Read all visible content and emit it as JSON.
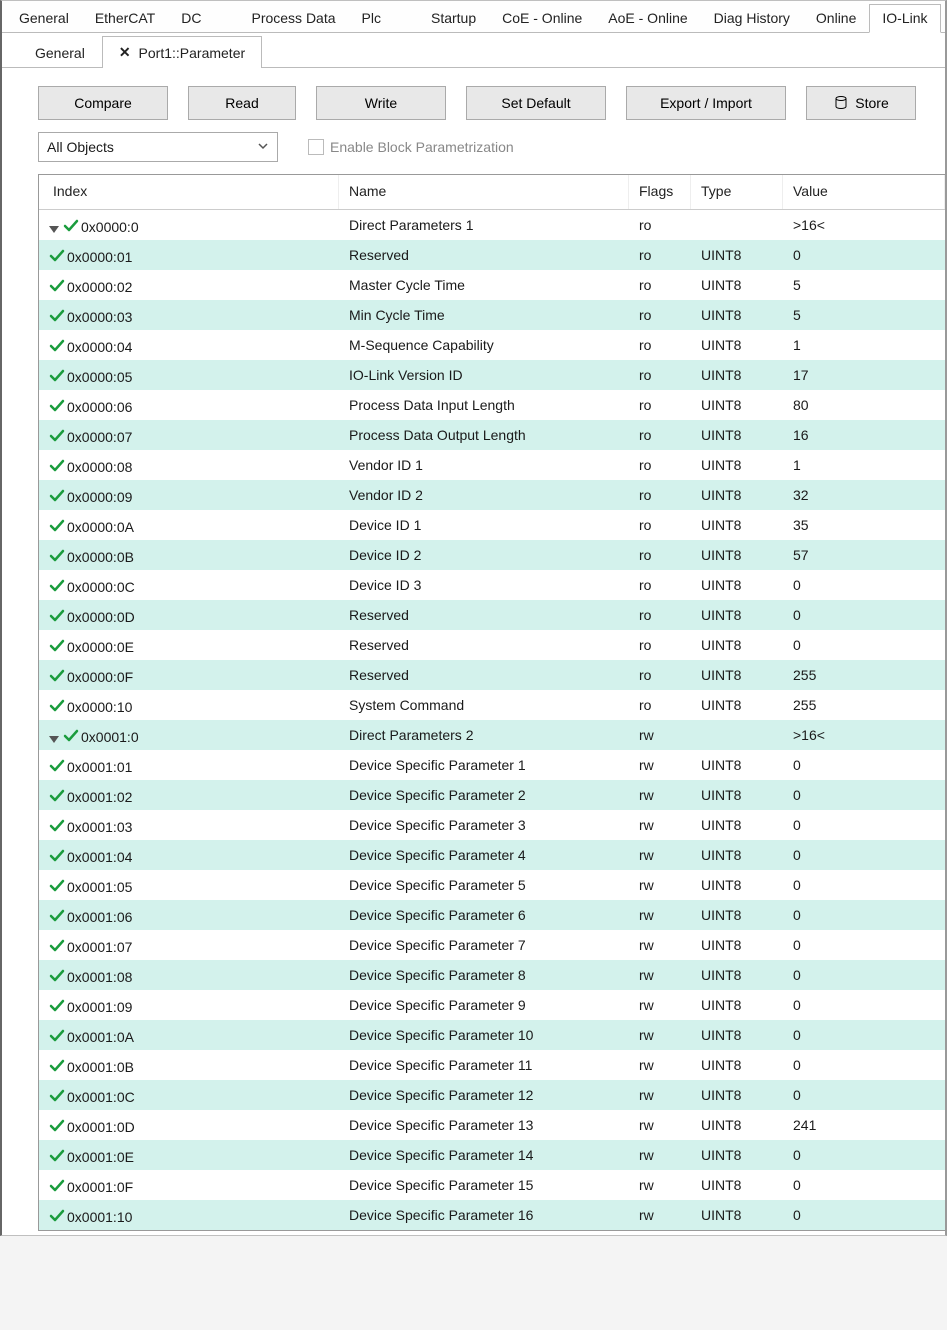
{
  "topTabs": [
    "General",
    "EtherCAT",
    "DC",
    "Process Data",
    "Plc",
    "Startup",
    "CoE - Online",
    "AoE - Online",
    "Diag History",
    "Online",
    "IO-Link"
  ],
  "topTabActive": 10,
  "subTabs": [
    {
      "label": "General",
      "closable": false
    },
    {
      "label": "Port1::Parameter",
      "closable": true
    }
  ],
  "subTabActive": 1,
  "toolbar": {
    "compare": "Compare",
    "read": "Read",
    "write": "Write",
    "setdefault": "Set Default",
    "exportimport": "Export / Import",
    "store": "Store"
  },
  "filter": {
    "dropdown": "All Objects",
    "checkbox": "Enable Block Parametrization"
  },
  "columns": {
    "index": "Index",
    "name": "Name",
    "flags": "Flags",
    "type": "Type",
    "value": "Value"
  },
  "rows": [
    {
      "kind": "parent",
      "index": "0x0000:0",
      "name": "Direct Parameters 1",
      "flags": "ro",
      "type": "",
      "value": ">16<"
    },
    {
      "kind": "child",
      "index": "0x0000:01",
      "name": "Reserved",
      "flags": "ro",
      "type": "UINT8",
      "value": "0"
    },
    {
      "kind": "child",
      "index": "0x0000:02",
      "name": "Master Cycle Time",
      "flags": "ro",
      "type": "UINT8",
      "value": "5"
    },
    {
      "kind": "child",
      "index": "0x0000:03",
      "name": "Min Cycle Time",
      "flags": "ro",
      "type": "UINT8",
      "value": "5"
    },
    {
      "kind": "child",
      "index": "0x0000:04",
      "name": "M-Sequence Capability",
      "flags": "ro",
      "type": "UINT8",
      "value": "1"
    },
    {
      "kind": "child",
      "index": "0x0000:05",
      "name": "IO-Link Version ID",
      "flags": "ro",
      "type": "UINT8",
      "value": "17"
    },
    {
      "kind": "child",
      "index": "0x0000:06",
      "name": "Process Data Input Length",
      "flags": "ro",
      "type": "UINT8",
      "value": "80"
    },
    {
      "kind": "child",
      "index": "0x0000:07",
      "name": "Process Data Output Length",
      "flags": "ro",
      "type": "UINT8",
      "value": "16"
    },
    {
      "kind": "child",
      "index": "0x0000:08",
      "name": "Vendor ID 1",
      "flags": "ro",
      "type": "UINT8",
      "value": "1"
    },
    {
      "kind": "child",
      "index": "0x0000:09",
      "name": "Vendor ID 2",
      "flags": "ro",
      "type": "UINT8",
      "value": "32"
    },
    {
      "kind": "child",
      "index": "0x0000:0A",
      "name": "Device ID 1",
      "flags": "ro",
      "type": "UINT8",
      "value": "35"
    },
    {
      "kind": "child",
      "index": "0x0000:0B",
      "name": "Device ID 2",
      "flags": "ro",
      "type": "UINT8",
      "value": "57"
    },
    {
      "kind": "child",
      "index": "0x0000:0C",
      "name": "Device ID 3",
      "flags": "ro",
      "type": "UINT8",
      "value": "0"
    },
    {
      "kind": "child",
      "index": "0x0000:0D",
      "name": "Reserved",
      "flags": "ro",
      "type": "UINT8",
      "value": "0"
    },
    {
      "kind": "child",
      "index": "0x0000:0E",
      "name": "Reserved",
      "flags": "ro",
      "type": "UINT8",
      "value": "0"
    },
    {
      "kind": "child",
      "index": "0x0000:0F",
      "name": "Reserved",
      "flags": "ro",
      "type": "UINT8",
      "value": "255"
    },
    {
      "kind": "child",
      "index": "0x0000:10",
      "name": "System Command",
      "flags": "ro",
      "type": "UINT8",
      "value": "255"
    },
    {
      "kind": "parent",
      "index": "0x0001:0",
      "name": "Direct Parameters 2",
      "flags": "rw",
      "type": "",
      "value": ">16<"
    },
    {
      "kind": "child",
      "index": "0x0001:01",
      "name": "Device Specific Parameter 1",
      "flags": "rw",
      "type": "UINT8",
      "value": "0"
    },
    {
      "kind": "child",
      "index": "0x0001:02",
      "name": "Device Specific Parameter 2",
      "flags": "rw",
      "type": "UINT8",
      "value": "0"
    },
    {
      "kind": "child",
      "index": "0x0001:03",
      "name": "Device Specific Parameter 3",
      "flags": "rw",
      "type": "UINT8",
      "value": "0"
    },
    {
      "kind": "child",
      "index": "0x0001:04",
      "name": "Device Specific Parameter 4",
      "flags": "rw",
      "type": "UINT8",
      "value": "0"
    },
    {
      "kind": "child",
      "index": "0x0001:05",
      "name": "Device Specific Parameter 5",
      "flags": "rw",
      "type": "UINT8",
      "value": "0"
    },
    {
      "kind": "child",
      "index": "0x0001:06",
      "name": "Device Specific Parameter 6",
      "flags": "rw",
      "type": "UINT8",
      "value": "0"
    },
    {
      "kind": "child",
      "index": "0x0001:07",
      "name": "Device Specific Parameter 7",
      "flags": "rw",
      "type": "UINT8",
      "value": "0"
    },
    {
      "kind": "child",
      "index": "0x0001:08",
      "name": "Device Specific Parameter 8",
      "flags": "rw",
      "type": "UINT8",
      "value": "0"
    },
    {
      "kind": "child",
      "index": "0x0001:09",
      "name": "Device Specific Parameter 9",
      "flags": "rw",
      "type": "UINT8",
      "value": "0"
    },
    {
      "kind": "child",
      "index": "0x0001:0A",
      "name": "Device Specific Parameter 10",
      "flags": "rw",
      "type": "UINT8",
      "value": "0"
    },
    {
      "kind": "child",
      "index": "0x0001:0B",
      "name": "Device Specific Parameter 11",
      "flags": "rw",
      "type": "UINT8",
      "value": "0"
    },
    {
      "kind": "child",
      "index": "0x0001:0C",
      "name": "Device Specific Parameter 12",
      "flags": "rw",
      "type": "UINT8",
      "value": "0"
    },
    {
      "kind": "child",
      "index": "0x0001:0D",
      "name": "Device Specific Parameter 13",
      "flags": "rw",
      "type": "UINT8",
      "value": "241"
    },
    {
      "kind": "child",
      "index": "0x0001:0E",
      "name": "Device Specific Parameter 14",
      "flags": "rw",
      "type": "UINT8",
      "value": "0"
    },
    {
      "kind": "child",
      "index": "0x0001:0F",
      "name": "Device Specific Parameter 15",
      "flags": "rw",
      "type": "UINT8",
      "value": "0"
    },
    {
      "kind": "child",
      "index": "0x0001:10",
      "name": "Device Specific Parameter 16",
      "flags": "rw",
      "type": "UINT8",
      "value": "0"
    }
  ]
}
